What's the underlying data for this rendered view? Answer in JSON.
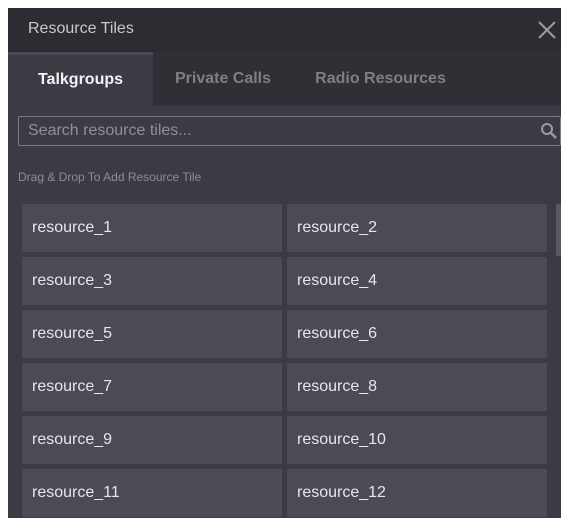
{
  "window": {
    "title": "Resource Tiles",
    "close_icon": "close-icon"
  },
  "tabs": [
    {
      "label": "Talkgroups",
      "active": true
    },
    {
      "label": "Private Calls",
      "active": false
    },
    {
      "label": "Radio Resources",
      "active": false
    }
  ],
  "search": {
    "placeholder": "Search resource tiles...",
    "value": "",
    "icon": "search-icon"
  },
  "hint": "Drag & Drop To Add Resource Tile",
  "tiles": [
    {
      "label": "resource_1"
    },
    {
      "label": "resource_2"
    },
    {
      "label": "resource_3"
    },
    {
      "label": "resource_4"
    },
    {
      "label": "resource_5"
    },
    {
      "label": "resource_6"
    },
    {
      "label": "resource_7"
    },
    {
      "label": "resource_8"
    },
    {
      "label": "resource_9"
    },
    {
      "label": "resource_10"
    },
    {
      "label": "resource_11"
    },
    {
      "label": "resource_12"
    }
  ],
  "colors": {
    "panel_bg": "#3b3c43",
    "title_bg": "#2c2d33",
    "tile_bg": "#4b4c53",
    "text_active": "#f2f2f4",
    "text_muted": "#7e7f86"
  }
}
